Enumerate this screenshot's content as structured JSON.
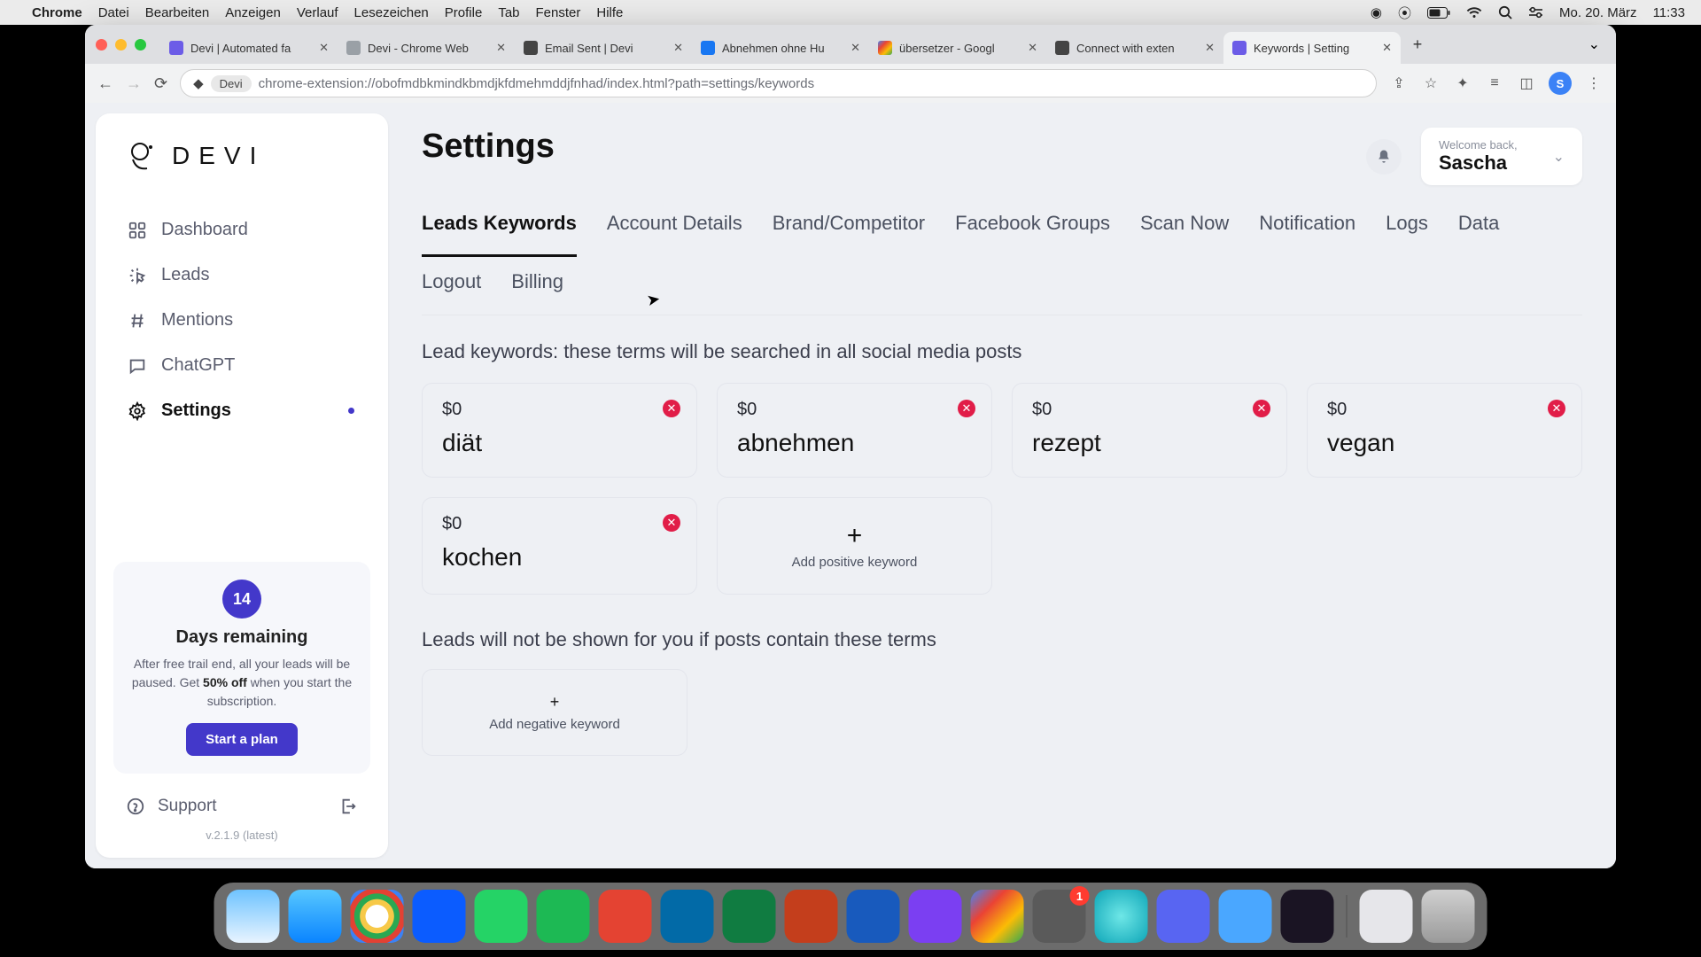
{
  "menubar": {
    "app": "Chrome",
    "items": [
      "Datei",
      "Bearbeiten",
      "Anzeigen",
      "Verlauf",
      "Lesezeichen",
      "Profile",
      "Tab",
      "Fenster",
      "Hilfe"
    ],
    "date": "Mo. 20. März",
    "time": "11:33"
  },
  "browser": {
    "tabs": [
      {
        "title": "Devi | Automated fa"
      },
      {
        "title": "Devi - Chrome Web"
      },
      {
        "title": "Email Sent | Devi"
      },
      {
        "title": "Abnehmen ohne Hu"
      },
      {
        "title": "übersetzer - Googl"
      },
      {
        "title": "Connect with exten"
      },
      {
        "title": "Keywords | Setting"
      }
    ],
    "url_badge": "Devi",
    "url": "chrome-extension://obofmdbkmindkbmdjkfdmehmddjfnhad/index.html?path=settings/keywords",
    "avatar": "S"
  },
  "sidebar": {
    "brand": "DEVI",
    "items": [
      {
        "label": "Dashboard"
      },
      {
        "label": "Leads"
      },
      {
        "label": "Mentions"
      },
      {
        "label": "ChatGPT"
      },
      {
        "label": "Settings"
      }
    ],
    "trial": {
      "days": "14",
      "title": "Days remaining",
      "text_a": "After free trail end, all your leads will be paused. Get ",
      "text_b": "50% off",
      "text_c": " when you start the subscription.",
      "cta": "Start a plan"
    },
    "support": "Support",
    "version": "v.2.1.9 (latest)"
  },
  "main": {
    "title": "Settings",
    "welcome": "Welcome back,",
    "user": "Sascha",
    "tabs": [
      "Leads Keywords",
      "Account Details",
      "Brand/Competitor",
      "Facebook Groups",
      "Scan Now",
      "Notification",
      "Logs",
      "Data",
      "Logout",
      "Billing"
    ],
    "lead_label": "Lead keywords: these terms will be searched in all social media posts",
    "keywords": [
      {
        "price": "$0",
        "word": "diät"
      },
      {
        "price": "$0",
        "word": "abnehmen"
      },
      {
        "price": "$0",
        "word": "rezept"
      },
      {
        "price": "$0",
        "word": "vegan"
      },
      {
        "price": "$0",
        "word": "kochen"
      }
    ],
    "add_positive": "Add positive keyword",
    "neg_label": "Leads will not be shown for you if posts contain these terms",
    "add_negative": "Add negative keyword"
  },
  "dock": {
    "badge": "1"
  }
}
